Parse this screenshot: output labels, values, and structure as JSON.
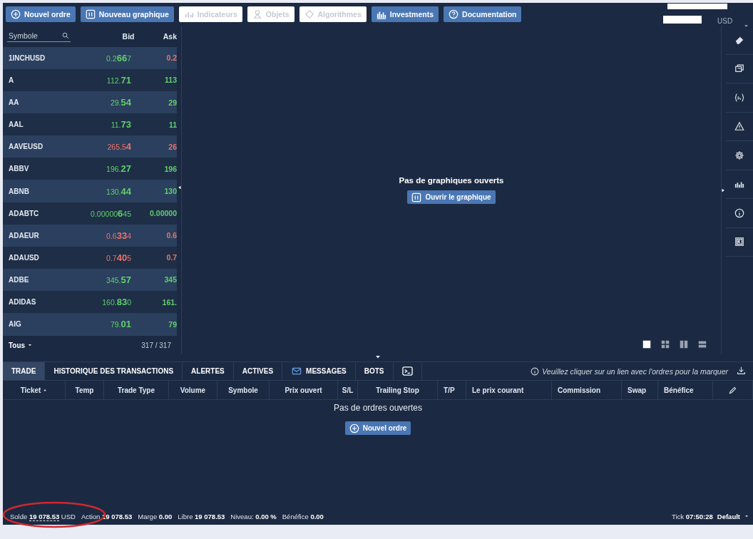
{
  "toolbar": {
    "buttons": [
      {
        "label": "Nouvel ordre",
        "disabled": false
      },
      {
        "label": "Nouveau graphique",
        "disabled": false
      },
      {
        "label": "Indicateurs",
        "disabled": true
      },
      {
        "label": "Objets",
        "disabled": true
      },
      {
        "label": "Algorithmes",
        "disabled": true
      },
      {
        "label": "Investments",
        "disabled": false
      },
      {
        "label": "Documentation",
        "disabled": false
      }
    ]
  },
  "account": {
    "currency": "USD"
  },
  "watchlist": {
    "search_placeholder": "Symbole",
    "columns": [
      "Bid",
      "Ask"
    ],
    "rows": [
      {
        "symbol": "1INCHUSD",
        "bid": "0.2**66**7",
        "bid_falling": false,
        "ask": "0.2",
        "ask_falling": true
      },
      {
        "symbol": "A",
        "bid": "112.**71**",
        "bid_falling": false,
        "ask": "113",
        "ask_falling": false
      },
      {
        "symbol": "AA",
        "bid": "29.**54**",
        "bid_falling": false,
        "ask": "29",
        "ask_falling": false
      },
      {
        "symbol": "AAL",
        "bid": "11.**73**",
        "bid_falling": false,
        "ask": "11",
        "ask_falling": false
      },
      {
        "symbol": "AAVEUSD",
        "bid": "265.5**4**",
        "bid_falling": true,
        "ask": "26",
        "ask_falling": true
      },
      {
        "symbol": "ABBV",
        "bid": "196.**27**",
        "bid_falling": false,
        "ask": "196",
        "ask_falling": false
      },
      {
        "symbol": "ABNB",
        "bid": "130.**44**",
        "bid_falling": false,
        "ask": "130",
        "ask_falling": false
      },
      {
        "symbol": "ADABTC",
        "bid": "0.00000**6**45",
        "bid_falling": false,
        "ask": "0.00000",
        "ask_falling": false
      },
      {
        "symbol": "ADAEUR",
        "bid": "0.6**33**4",
        "bid_falling": true,
        "ask": "0.6",
        "ask_falling": true
      },
      {
        "symbol": "ADAUSD",
        "bid": "0.7**40**5",
        "bid_falling": true,
        "ask": "0.7",
        "ask_falling": true
      },
      {
        "symbol": "ADBE",
        "bid": "345.**57**",
        "bid_falling": false,
        "ask": "345",
        "ask_falling": false
      },
      {
        "symbol": "ADIDAS",
        "bid": "160.**83**0",
        "bid_falling": false,
        "ask": "161.",
        "ask_falling": false
      },
      {
        "symbol": "AIG",
        "bid": "79.**01**",
        "bid_falling": false,
        "ask": "79",
        "ask_falling": false
      }
    ],
    "filter": "Tous",
    "count": "317 / 317"
  },
  "chart_area": {
    "empty_message": "Pas de graphiques ouverts",
    "open_button": "Ouvrir le graphique",
    "layouts": [
      {
        "kind": "single",
        "selected": true
      },
      {
        "kind": "grid",
        "selected": false
      },
      {
        "kind": "columns",
        "selected": false
      },
      {
        "kind": "rows",
        "selected": false
      }
    ]
  },
  "bottom_panel": {
    "tabs": [
      {
        "label": "TRADE",
        "selected": true
      },
      {
        "label": "HISTORIQUE DES TRANSACTIONS",
        "selected": false
      },
      {
        "label": "ALERTES",
        "selected": false
      },
      {
        "label": "ACTIVES",
        "selected": false
      },
      {
        "label": "MESSAGES",
        "selected": false
      },
      {
        "label": "BOTS",
        "selected": false
      }
    ],
    "console_tab": {
      "selected": false
    },
    "hint": "Veuillez cliquer sur un lien avec l'ordres pour la marquer",
    "columns": [
      "Ticket",
      "Temp",
      "Trade Type",
      "Volume",
      "Symbole",
      "Prix ouvert",
      "S/L",
      "Trailing Stop",
      "T/P",
      "Le prix courant",
      "Commission",
      "Swap",
      "Bénéfice"
    ],
    "empty_message": "Pas de ordres ouvertes",
    "new_order_button": "Nouvel ordre"
  },
  "status_bar": {
    "items": [
      {
        "label": "Solde",
        "value": "19 078.53",
        "unit": "USD"
      },
      {
        "label": "Action",
        "value": "19 078.53"
      },
      {
        "label": "Marge",
        "value": "0.00"
      },
      {
        "label": "Libre",
        "value": "19 078.53"
      },
      {
        "label": "Niveau:",
        "value": "0.00 %"
      },
      {
        "label": "Bénéfice",
        "value": "0.00"
      }
    ],
    "tick_label": "Tick",
    "tick_time": "07:50:28",
    "profile": "Default"
  }
}
